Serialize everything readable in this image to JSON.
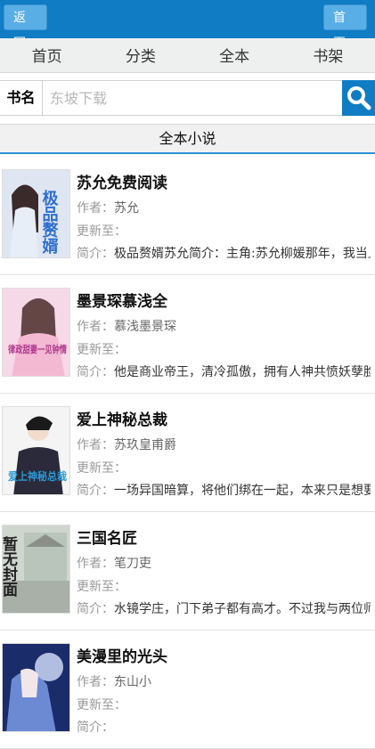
{
  "topbar": {
    "back_label": "返回",
    "home_label": "首页"
  },
  "nav": {
    "items": [
      "首页",
      "分类",
      "全本",
      "书架"
    ]
  },
  "search": {
    "label": "书名",
    "placeholder": "东坡下载"
  },
  "section": {
    "title": "全本小说"
  },
  "labels": {
    "author": "作者：",
    "update": "更新至：",
    "intro": "简介："
  },
  "books": [
    {
      "title": "苏允免费阅读",
      "author": "苏允",
      "update": "",
      "intro": "极品赘婿苏允简介：主角:苏允柳媛那年，我当上..."
    },
    {
      "title": "墨景琛慕浅全",
      "author": "慕浅墨景琛",
      "update": "",
      "intro": "他是商业帝王，清冷孤傲，拥有人神共愤妖孽脸..."
    },
    {
      "title": "爱上神秘总裁",
      "author": "苏玖皇甫爵",
      "update": "",
      "intro": "一场异国暗算，将他们绑在一起，本来只是想要..."
    },
    {
      "title": "三国名匠",
      "author": "笔刀吏",
      "update": "",
      "intro": "水镜学庄，门下弟子都有高才。不过我与两位师..."
    },
    {
      "title": "美漫里的光头",
      "author": "东山小",
      "update": "",
      "intro": ""
    }
  ],
  "covers": [
    {
      "text": "极品赘婿",
      "color": "#2d6fd0"
    },
    {
      "text": "律政甜妻一见钟情",
      "color": "#b0388f"
    },
    {
      "text": "爱上神秘总裁",
      "color": "#2a9ad6"
    },
    {
      "text": "暂无封面",
      "color": "#222222"
    },
    {
      "text": "",
      "color": "#3a5ecc"
    }
  ]
}
